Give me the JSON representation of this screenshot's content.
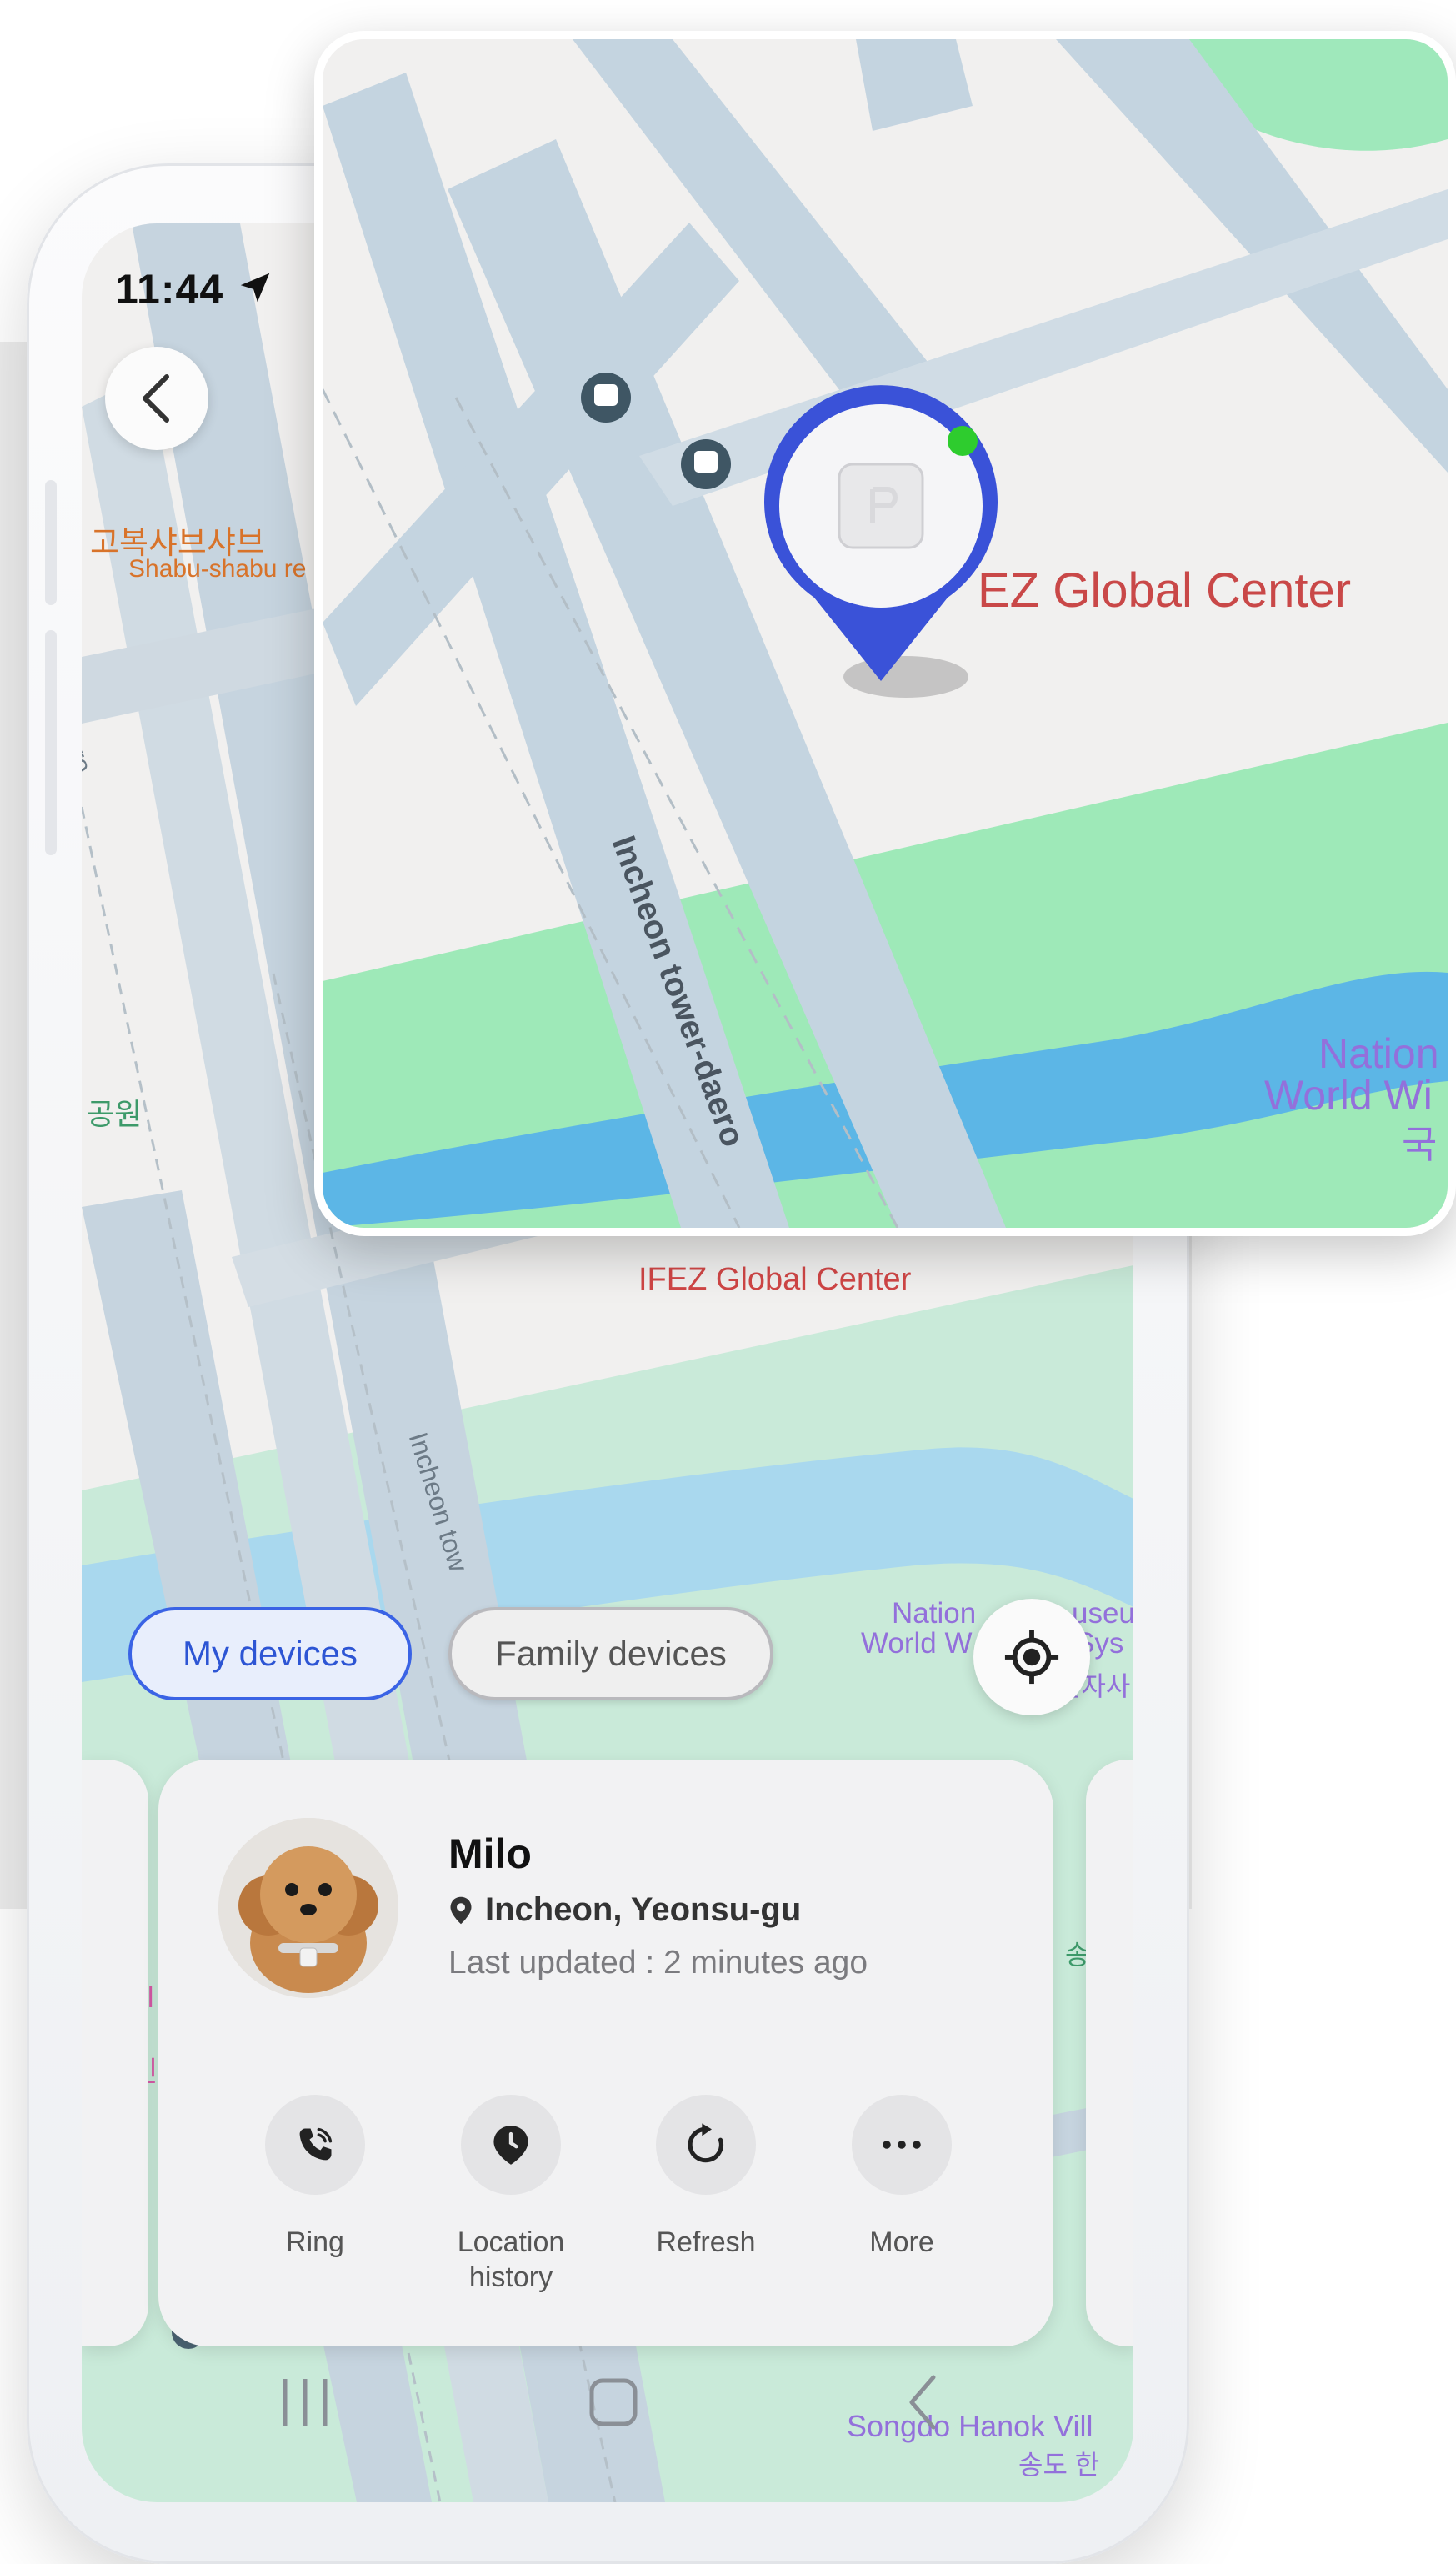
{
  "status_bar": {
    "time": "11:44"
  },
  "map_labels": {
    "restaurant_ko": "고복샤브샤브",
    "restaurant_en": "Shabu-shabu re",
    "road_side": "daero",
    "park_ko": "공원",
    "building": "IFEZ Global Center",
    "road_main": "Incheon tow",
    "museum_en1": "Nation",
    "museum_en1b": "useu",
    "museum_en2": "World W",
    "museum_en2b": "Sys",
    "museum_ko": "물자사",
    "left_edge_1": "ol",
    "left_edge_2": "n",
    "left_edge_3": "인",
    "right_edge": "송",
    "village_en": "Songdo Hanok Vill",
    "village_ko": "송도 한"
  },
  "inset_labels": {
    "building": "EZ Global Center",
    "road": "Incheon tower-daero",
    "museum_1": "Nation",
    "museum_2": "World Wi",
    "museum_3": "국"
  },
  "tabs": {
    "my_devices": "My devices",
    "family_devices": "Family devices"
  },
  "device": {
    "name": "Milo",
    "location": "Incheon, Yeonsu-gu",
    "last_updated": "Last updated : 2 minutes ago"
  },
  "actions": {
    "ring": "Ring",
    "location_history_1": "Location",
    "location_history_2": "history",
    "refresh": "Refresh",
    "more": "More"
  },
  "colors": {
    "accent": "#3a63e5",
    "map_road": "#c6d4df",
    "map_park": "#c9ead9",
    "map_water": "#5cb6e6",
    "online_dot": "#2ecc2e"
  }
}
